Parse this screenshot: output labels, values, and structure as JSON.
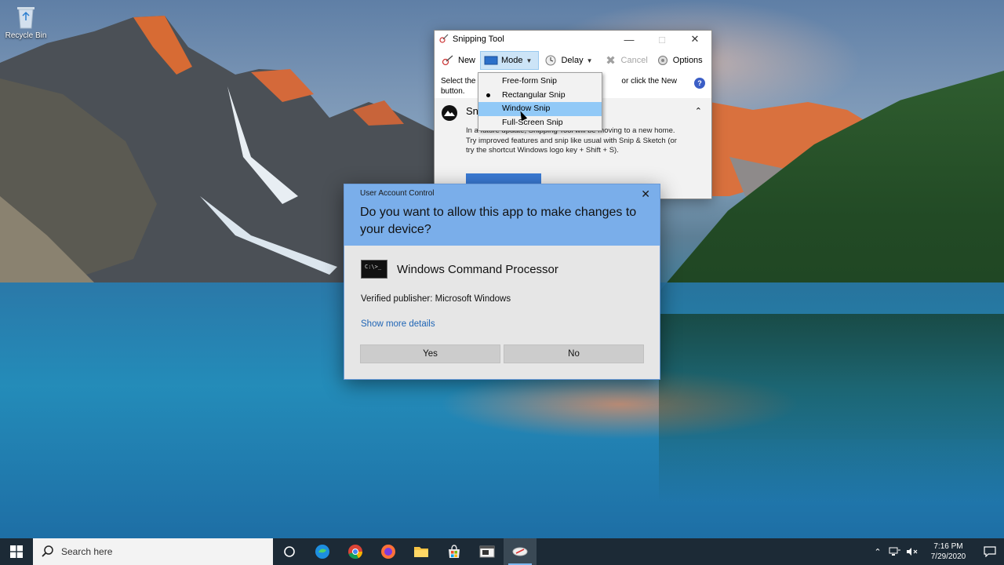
{
  "desktop": {
    "recycle_bin_label": "Recycle Bin"
  },
  "snipping_tool": {
    "title": "Snipping Tool",
    "toolbar": {
      "new_label": "New",
      "mode_label": "Mode",
      "delay_label": "Delay",
      "cancel_label": "Cancel",
      "options_label": "Options"
    },
    "instruction_start": "Select the",
    "instruction_end": "or click the New",
    "instruction_line2": "button.",
    "notice_heading": "Sn",
    "notice_text": "In a future update, Snipping Tool will be moving to a new home. Try improved features and snip like usual with Snip & Sketch (or try the shortcut Windows logo key + Shift + S).",
    "mode_menu": {
      "items": [
        {
          "label": "Free-form Snip"
        },
        {
          "label": "Rectangular Snip"
        },
        {
          "label": "Window Snip"
        },
        {
          "label": "Full-Screen Snip"
        }
      ],
      "checked_index": 1,
      "highlighted_index": 2
    }
  },
  "uac": {
    "caption": "User Account Control",
    "question": "Do you want to allow this app to make changes to your device?",
    "app_name": "Windows Command Processor",
    "publisher": "Verified publisher: Microsoft Windows",
    "more_details": "Show more details",
    "yes_label": "Yes",
    "no_label": "No",
    "header_color": "#7aaeea"
  },
  "taskbar": {
    "search_placeholder": "Search here",
    "apps": [
      {
        "icon": "task-view-icon"
      },
      {
        "icon": "edge-icon"
      },
      {
        "icon": "chrome-icon"
      },
      {
        "icon": "firefox-icon"
      },
      {
        "icon": "file-explorer-icon"
      },
      {
        "icon": "store-icon"
      },
      {
        "icon": "app-window-icon"
      },
      {
        "icon": "snipping-tool-icon"
      }
    ],
    "time": "7:16 PM",
    "date": "7/29/2020"
  }
}
